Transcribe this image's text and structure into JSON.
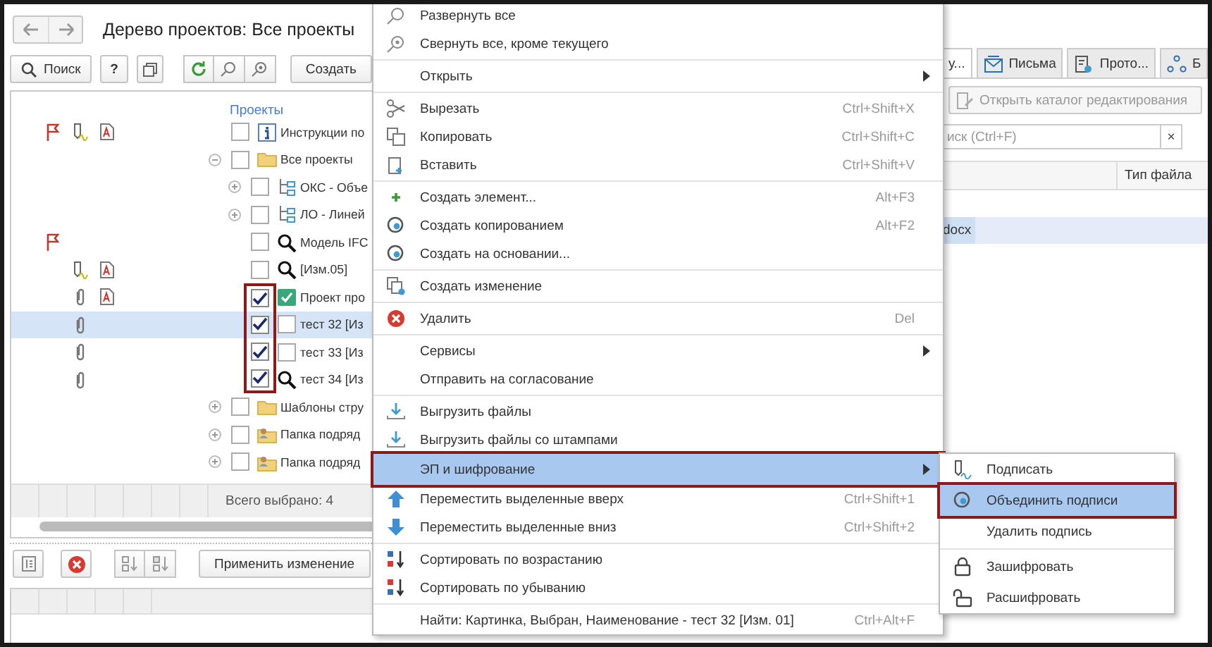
{
  "window": {
    "title": "Дерево проектов: Все проекты"
  },
  "toolbar": {
    "search_button": "Поиск",
    "help_button": "?",
    "create_button": "Создать"
  },
  "tree": {
    "column_header": "Проекты",
    "footer": "Всего выбрано: 4",
    "rows": [
      {
        "label": "Инструкции по",
        "kind": "instruction",
        "flagged": true,
        "signed": true,
        "pdf": true,
        "checked": false,
        "outlined": false,
        "selected": false
      },
      {
        "label": "Все проекты",
        "kind": "folder",
        "expanded": true,
        "checked": false,
        "outlined": false,
        "selected": false,
        "children": [
          {
            "label": "ОКС - Объе",
            "kind": "structure",
            "expanded": false,
            "checked": false,
            "outlined": false,
            "selected": false
          },
          {
            "label": "ЛО - Линей",
            "kind": "structure",
            "expanded": false,
            "checked": false,
            "outlined": false,
            "selected": false
          },
          {
            "label": "Модель IFC",
            "kind": "model",
            "flagged": true,
            "checked": false,
            "outlined": false,
            "selected": false
          },
          {
            "label": "[Изм.05]",
            "kind": "model",
            "signed": true,
            "pdf": true,
            "checked": false,
            "outlined": false,
            "selected": false
          },
          {
            "label": "Проект про",
            "kind": "approved",
            "attached": true,
            "pdf": true,
            "checked": true,
            "outlined": true,
            "selected": false
          },
          {
            "label": "тест 32 [Из",
            "kind": "document",
            "attached": true,
            "checked": true,
            "outlined": true,
            "selected": true
          },
          {
            "label": "тест 33 [Из",
            "kind": "document",
            "attached": true,
            "checked": true,
            "outlined": true,
            "selected": false
          },
          {
            "label": "тест 34 [Из",
            "kind": "model",
            "attached": true,
            "checked": true,
            "outlined": true,
            "selected": false
          }
        ]
      },
      {
        "label": "Шаблоны стру",
        "kind": "folder",
        "expanded": false,
        "checked": false,
        "outlined": false,
        "selected": false
      },
      {
        "label": "Папка подряд",
        "kind": "contractor-folder",
        "expanded": false,
        "checked": false,
        "outlined": false,
        "selected": false
      },
      {
        "label": "Папка подряд",
        "kind": "contractor-folder",
        "expanded": false,
        "checked": false,
        "outlined": false,
        "selected": false
      }
    ]
  },
  "bottom_toolbar": {
    "apply_button": "Применить изменение"
  },
  "right_panel": {
    "tabs": [
      {
        "label": "у...",
        "selected": true
      },
      {
        "label": "Письма",
        "selected": false
      },
      {
        "label": "Прото...",
        "selected": false
      },
      {
        "label": "Б",
        "selected": false
      }
    ],
    "open_catalog_button": {
      "label": "Открыть каталог редактирования",
      "disabled": true
    },
    "search": {
      "placeholder": "иск (Ctrl+F)",
      "clear": "×"
    },
    "columns": [
      {
        "label": "Тип файла"
      }
    ],
    "rows": [
      {
        "column_1": "docx",
        "selected": true
      }
    ]
  },
  "context_menu": {
    "items": [
      {
        "kind": "item",
        "label": "Развернуть все",
        "has_submenu": false,
        "selected": false,
        "outlined": false
      },
      {
        "kind": "item",
        "label": "Свернуть все, кроме текущего",
        "has_submenu": false,
        "selected": false,
        "outlined": false
      },
      {
        "kind": "separator"
      },
      {
        "kind": "item",
        "label": "Открыть",
        "has_submenu": true,
        "selected": false,
        "outlined": false
      },
      {
        "kind": "separator"
      },
      {
        "kind": "item",
        "label": "Вырезать",
        "shortcut": "Ctrl+Shift+X",
        "has_submenu": false,
        "selected": false,
        "outlined": false
      },
      {
        "kind": "item",
        "label": "Копировать",
        "shortcut": "Ctrl+Shift+C",
        "has_submenu": false,
        "selected": false,
        "outlined": false
      },
      {
        "kind": "item",
        "label": "Вставить",
        "shortcut": "Ctrl+Shift+V",
        "has_submenu": false,
        "selected": false,
        "outlined": false
      },
      {
        "kind": "separator"
      },
      {
        "kind": "item",
        "label": "Создать элемент...",
        "shortcut": "Alt+F3",
        "has_submenu": false,
        "selected": false,
        "outlined": false
      },
      {
        "kind": "item",
        "label": "Создать копированием",
        "shortcut": "Alt+F2",
        "has_submenu": false,
        "selected": false,
        "outlined": false
      },
      {
        "kind": "item",
        "label": "Создать на основании...",
        "has_submenu": false,
        "selected": false,
        "outlined": false
      },
      {
        "kind": "separator"
      },
      {
        "kind": "item",
        "label": "Создать изменение",
        "has_submenu": false,
        "selected": false,
        "outlined": false
      },
      {
        "kind": "separator"
      },
      {
        "kind": "item",
        "label": "Удалить",
        "shortcut": "Del",
        "has_submenu": false,
        "selected": false,
        "outlined": false
      },
      {
        "kind": "separator"
      },
      {
        "kind": "item",
        "label": "Сервисы",
        "has_submenu": true,
        "selected": false,
        "outlined": false
      },
      {
        "kind": "item",
        "label": "Отправить на согласование",
        "has_submenu": false,
        "selected": false,
        "outlined": false
      },
      {
        "kind": "separator"
      },
      {
        "kind": "item",
        "label": "Выгрузить файлы",
        "has_submenu": false,
        "selected": false,
        "outlined": false
      },
      {
        "kind": "item",
        "label": "Выгрузить файлы со штампами",
        "has_submenu": false,
        "selected": false,
        "outlined": false
      },
      {
        "kind": "item",
        "label": "ЭП и шифрование",
        "has_submenu": true,
        "selected": true,
        "outlined": true
      },
      {
        "kind": "item",
        "label": "Переместить выделенные вверх",
        "shortcut": "Ctrl+Shift+1",
        "has_submenu": false,
        "selected": false,
        "outlined": false
      },
      {
        "kind": "item",
        "label": "Переместить выделенные вниз",
        "shortcut": "Ctrl+Shift+2",
        "has_submenu": false,
        "selected": false,
        "outlined": false
      },
      {
        "kind": "separator"
      },
      {
        "kind": "item",
        "label": "Сортировать по возрастанию",
        "has_submenu": false,
        "selected": false,
        "outlined": false
      },
      {
        "kind": "item",
        "label": "Сортировать по убыванию",
        "has_submenu": false,
        "selected": false,
        "outlined": false
      },
      {
        "kind": "separator"
      },
      {
        "kind": "item",
        "label": "Найти: Картинка, Выбран, Наименование - тест 32 [Изм. 01]",
        "shortcut": "Ctrl+Alt+F",
        "has_submenu": false,
        "selected": false,
        "outlined": false
      }
    ]
  },
  "submenu": {
    "items": [
      {
        "kind": "item",
        "label": "Подписать",
        "selected": false,
        "outlined": false
      },
      {
        "kind": "item",
        "label": "Объединить подписи",
        "selected": true,
        "outlined": true
      },
      {
        "kind": "item",
        "label": "Удалить подпись",
        "selected": false,
        "outlined": false
      },
      {
        "kind": "separator"
      },
      {
        "kind": "item",
        "label": "Зашифровать",
        "selected": false,
        "outlined": false
      },
      {
        "kind": "item",
        "label": "Расшифровать",
        "selected": false,
        "outlined": false
      }
    ]
  }
}
